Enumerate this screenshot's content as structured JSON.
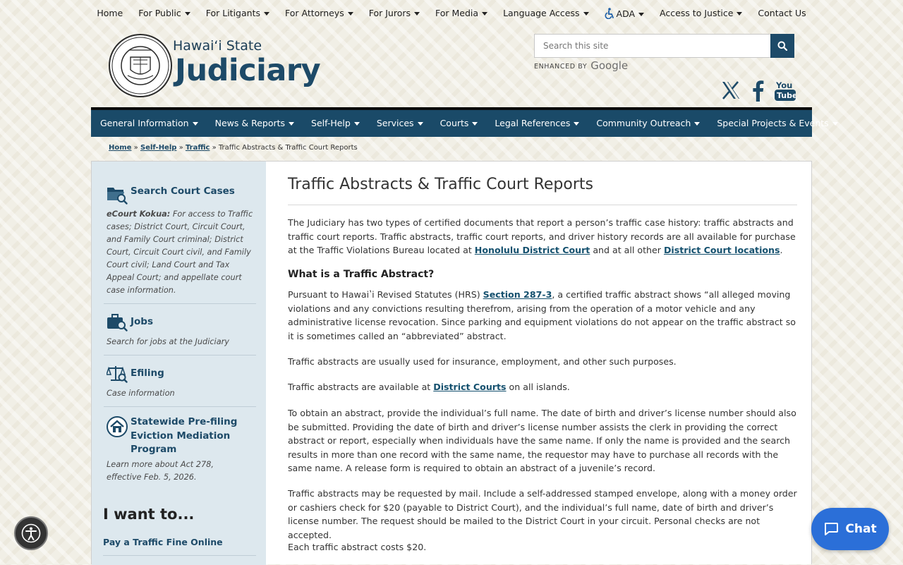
{
  "top_nav": [
    {
      "label": "Home",
      "dropdown": false
    },
    {
      "label": "For Public",
      "dropdown": true
    },
    {
      "label": "For Litigants",
      "dropdown": true
    },
    {
      "label": "For Attorneys",
      "dropdown": true
    },
    {
      "label": "For Jurors",
      "dropdown": true
    },
    {
      "label": "For Media",
      "dropdown": true
    },
    {
      "label": "Language Access",
      "dropdown": true
    },
    {
      "label": "ADA",
      "dropdown": true,
      "icon": "wheelchair-icon"
    },
    {
      "label": "Access to Justice",
      "dropdown": true
    },
    {
      "label": "Contact Us",
      "dropdown": false
    }
  ],
  "header": {
    "seal_text_top": "JUDICIARY",
    "seal_text_bottom": "STATE OF HAWAII",
    "brand_small": "Hawaiʻi State",
    "brand_big": "Judiciary"
  },
  "search": {
    "placeholder": "Search this site",
    "enhanced_by": "ENHANCED BY",
    "google": "Google",
    "button_icon": "search-icon"
  },
  "social": [
    "x-icon",
    "facebook-icon",
    "youtube-icon"
  ],
  "main_nav": [
    "General Information",
    "News & Reports",
    "Self-Help",
    "Services",
    "Courts",
    "Legal References",
    "Community Outreach",
    "Special Projects & Events"
  ],
  "breadcrumb": {
    "home": "Home",
    "self_help": "Self-Help",
    "traffic": "Traffic",
    "sep": "»",
    "current": "Traffic Abstracts & Traffic Court Reports"
  },
  "sidebar": {
    "search_court_cases": {
      "title": "Search Court Cases",
      "desc_bold": "eCourt Kokua:",
      "desc": " For access to Traffic cases; District Court, Circuit Court, and Family Court criminal; District Court, Circuit Court civil, and Family Court civil; Land Court and Tax Appeal Court; and appellate court case information."
    },
    "jobs": {
      "title": "Jobs",
      "desc": "Search for jobs at the Judiciary"
    },
    "efiling": {
      "title": "Efiling",
      "desc": "Case information"
    },
    "eviction": {
      "title_line1": "Statewide Pre-filing",
      "title_line2": "Eviction Mediation",
      "title_line3": "Program",
      "desc": "Learn more about Act 278, effective Feb. 5, 2026."
    },
    "i_want_to": "I want to...",
    "want_link": "Pay a Traffic Fine Online"
  },
  "article": {
    "title": "Traffic Abstracts & Traffic Court Reports",
    "intro_1": "The Judiciary has two types of certified documents that report a person’s traffic case history: traffic abstracts and traffic court reports.  Traffic abstracts, traffic court reports, and driver history records are all available for purchase at the Traffic Violations Bureau located at ",
    "intro_link1": "Honolulu District Court",
    "intro_2": " and at all other  ",
    "intro_link2": "District Court locations",
    "intro_3": ".",
    "h_what": "What is a Traffic Abstract?",
    "what_1": "Pursuant to Hawaiʽi Revised Statutes (HRS) ",
    "what_link": "Section 287-3",
    "what_2": ", a certified traffic abstract shows “all alleged moving violations and any convictions resulting therefrom, arising from the operation of a motor vehicle and any administrative license revocation.  Since parking and equipment violations do not appear on the traffic abstract so it is sometimes called an “abbreviated” abstract.",
    "uses": "Traffic abstracts are usually used for insurance, employment, and other such purposes.",
    "avail_1": "Traffic abstracts are available at ",
    "avail_link": "District Courts",
    "avail_2": " on all islands.",
    "obtain": "To obtain an abstract, provide the individual’s full name. The date of birth and driver’s license number should also be submitted. Providing the date of birth and driver’s license number assists the clerk in providing the correct abstract or report, especially when individuals have the same name. If only the name is provided and the search results in more than one record with the same name, the requestor may have to purchase all records with the same name. A release form is required to obtain an abstract of a juvenile’s record.",
    "mail": "Traffic abstracts may be requested by mail. Include a self-addressed stamped envelope, along with a money order or cashiers check for $20 (payable to District Court), and the individual’s full name, date of birth and driver’s license number. The request should be mailed to the District Court in your circuit. Personal checks are not accepted.",
    "cost": "Each traffic abstract costs $20."
  },
  "floating": {
    "chat_label": "Chat",
    "accessibility_icon": "accessibility-icon"
  },
  "colors": {
    "brand_navy": "#1a4a68",
    "link": "#14506e",
    "sidebar_bg": "#dde8ee",
    "chat_blue": "#2b6fd8"
  }
}
